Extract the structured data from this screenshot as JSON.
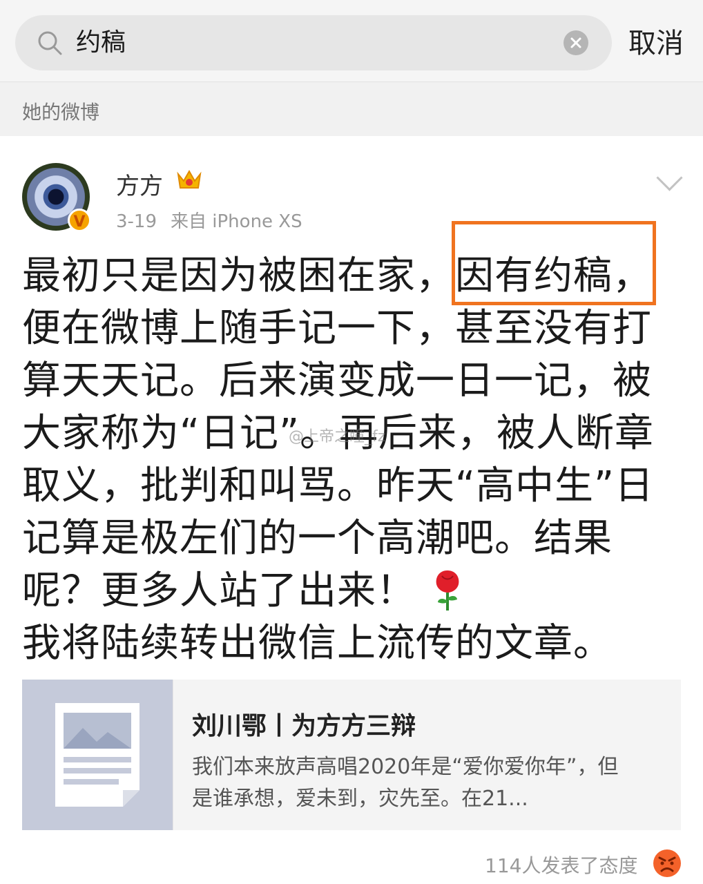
{
  "search": {
    "value": "约稿",
    "cancel_label": "取消"
  },
  "section": {
    "title": "她的微博"
  },
  "post": {
    "username": "方方",
    "date": "3-19",
    "source": "来自 iPhone XS",
    "text": "最初只是因为被困在家，因有约稿，\n便在微博上随手记一下，甚至没有打\n算天天记。后来演变成一日一记，被\n大家称为“日记”。再后来，被人断章\n取义，批判和叫骂。昨天“高中生”日\n记算是极左们的一个高潮吧。结果\n呢？更多人站了出来！\n我将陆续转出微信上流传的文章。",
    "watermark": "@上帝之瞳_fz",
    "verified_glyph": "V"
  },
  "card": {
    "title": "刘川鄂丨为方方三辩",
    "desc": "我们本来放声高唱2020年是“爱你爱你年”，但是谁承想，爱未到，灾先至。在21..."
  },
  "footer": {
    "reactions_text": "114人发表了态度"
  },
  "colors": {
    "highlight": "#f0731f",
    "accent_orange": "#f6a300"
  },
  "icons": [
    "search-icon",
    "clear-icon",
    "crown-icon",
    "chevron-down-icon",
    "rose-icon",
    "document-icon",
    "angry-face-icon"
  ]
}
